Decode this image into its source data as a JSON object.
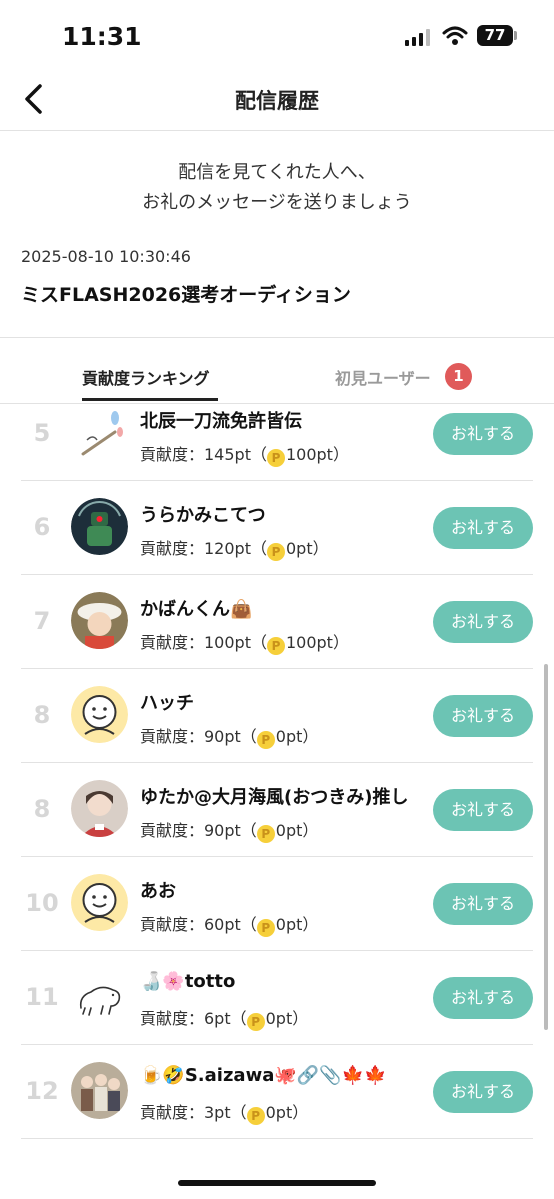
{
  "status": {
    "time": "11:31",
    "battery": "77"
  },
  "nav": {
    "title": "配信履歴"
  },
  "message": {
    "line1": "配信を見てくれた人へ、",
    "line2": "お礼のメッセージを送りましょう"
  },
  "stream": {
    "date": "2025-08-10 10:30:46",
    "title": "ミスFLASH2026選考オーディション"
  },
  "tabs": {
    "ranking": "貢献度ランキング",
    "first_time": "初見ユーザー",
    "first_time_count": "1"
  },
  "thank_label": "お礼する",
  "rows": [
    {
      "rank": "5",
      "name": "北辰一刀流免許皆伝",
      "contrib_label": "貢献度：145pt（",
      "coin": "P",
      "points": "100pt）",
      "avatar": "sketch-avatar"
    },
    {
      "rank": "6",
      "name": "うらかみこてつ",
      "contrib_label": "貢献度：120pt（",
      "coin": "P",
      "points": "0pt）",
      "avatar": "robot-avatar"
    },
    {
      "rank": "7",
      "name": "かばんくん👜",
      "contrib_label": "貢献度：100pt（",
      "coin": "P",
      "points": "100pt）",
      "avatar": "character-avatar"
    },
    {
      "rank": "8",
      "name": "ハッチ",
      "contrib_label": "貢献度：90pt（",
      "coin": "P",
      "points": "0pt）",
      "avatar": "default-face-avatar"
    },
    {
      "rank": "8",
      "name": "ゆたか@大月海風(おつきみ)推し",
      "contrib_label": "貢献度：90pt（",
      "coin": "P",
      "points": "0pt）",
      "avatar": "photo-avatar"
    },
    {
      "rank": "10",
      "name": "あお",
      "contrib_label": "貢献度：60pt（",
      "coin": "P",
      "points": "0pt）",
      "avatar": "default-face-avatar"
    },
    {
      "rank": "11",
      "name": "🍶🌸totto",
      "contrib_label": "貢献度：6pt（",
      "coin": "P",
      "points": "0pt）",
      "avatar": "animal-sketch-avatar"
    },
    {
      "rank": "12",
      "name": "🍺🤣S.aizawa🐙🔗📎🍁🍁",
      "contrib_label": "貢献度：3pt（",
      "coin": "P",
      "points": "0pt）",
      "avatar": "group-photo-avatar"
    }
  ],
  "colors": {
    "accent": "#6cc4b4",
    "badge": "#e05a5a",
    "coin": "#f6cf3a",
    "default_avatar_bg": "#fde9a6"
  }
}
